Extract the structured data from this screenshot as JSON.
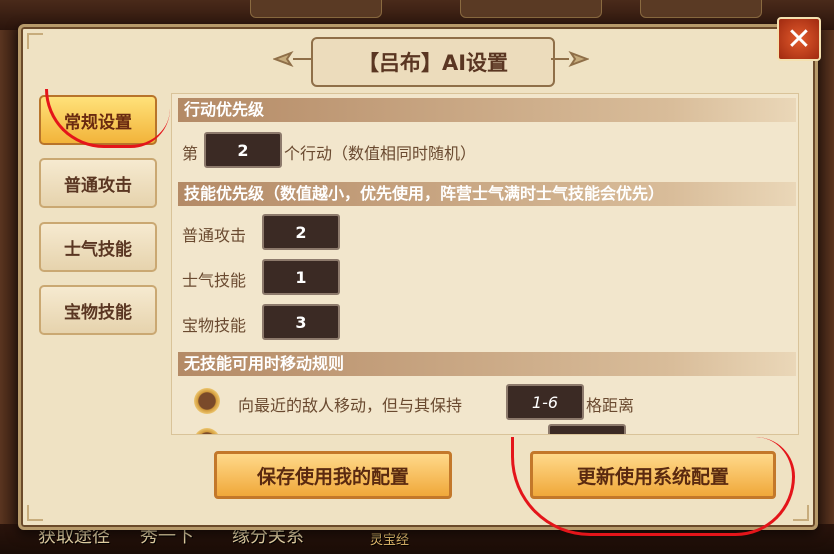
{
  "background": {
    "bottom_labels": [
      "获取途径",
      "秀一下",
      "缘分关系"
    ],
    "lingbao_label": "灵宝经"
  },
  "dialog": {
    "title": "【吕布】AI设置",
    "close_icon": "close-x-icon"
  },
  "tabs": [
    {
      "label": "常规设置",
      "active": true
    },
    {
      "label": "普通攻击",
      "active": false
    },
    {
      "label": "士气技能",
      "active": false
    },
    {
      "label": "宝物技能",
      "active": false
    }
  ],
  "sections": {
    "action_priority": {
      "heading": "行动优先级",
      "prefix": "第",
      "value": "2",
      "suffix": "个行动（数值相同时随机）"
    },
    "skill_priority": {
      "heading": "技能优先级（数值越小，优先使用，阵营士气满时士气技能会优先）",
      "rows": [
        {
          "label": "普通攻击",
          "value": "2"
        },
        {
          "label": "士气技能",
          "value": "1"
        },
        {
          "label": "宝物技能",
          "value": "3"
        }
      ]
    },
    "move_rule": {
      "heading": "无技能可用时移动规则",
      "option_text": "向最近的敌人移动，但与其保持",
      "range_value": "1-6",
      "range_suffix": "格距离"
    }
  },
  "buttons": {
    "save_mine": "保存使用我的配置",
    "update_system": "更新使用系统配置"
  },
  "colors": {
    "annotation_red": "#e4151a",
    "active_tab": "#f2b43a",
    "panel_bg": "#efe2c3"
  }
}
